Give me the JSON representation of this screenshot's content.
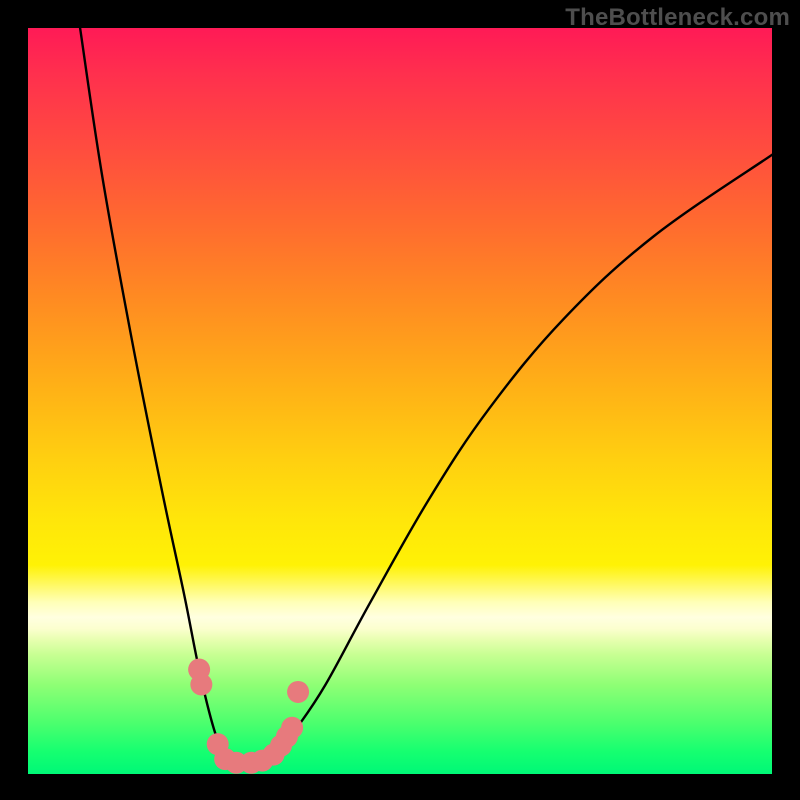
{
  "watermark": "TheBottleneck.com",
  "chart_data": {
    "type": "line",
    "title": "",
    "xlabel": "",
    "ylabel": "",
    "xlim": [
      0,
      100
    ],
    "ylim": [
      0,
      100
    ],
    "series": [
      {
        "name": "curve",
        "x": [
          7,
          10,
          14,
          18,
          21,
          23,
          25,
          26.5,
          28,
          30,
          32,
          34,
          36,
          40,
          46,
          54,
          62,
          72,
          84,
          100
        ],
        "y": [
          100,
          80,
          58,
          38,
          24,
          14,
          6,
          2.5,
          1.5,
          1.5,
          2,
          3.5,
          6,
          12,
          23,
          37,
          49,
          61,
          72,
          83
        ]
      }
    ],
    "markers": {
      "name": "highlight-dots",
      "color": "#e77a7d",
      "points": [
        {
          "x": 23.0,
          "y": 14.0
        },
        {
          "x": 23.3,
          "y": 12.0
        },
        {
          "x": 25.5,
          "y": 4.0
        },
        {
          "x": 26.5,
          "y": 2.0
        },
        {
          "x": 28.0,
          "y": 1.5
        },
        {
          "x": 30.0,
          "y": 1.5
        },
        {
          "x": 31.5,
          "y": 1.8
        },
        {
          "x": 33.0,
          "y": 2.6
        },
        {
          "x": 34.0,
          "y": 3.8
        },
        {
          "x": 34.8,
          "y": 5.0
        },
        {
          "x": 35.5,
          "y": 6.2
        },
        {
          "x": 36.3,
          "y": 11.0
        }
      ]
    },
    "gradient_bands": [
      {
        "stop": 0,
        "color": "#ff1a56"
      },
      {
        "stop": 46,
        "color": "#ffaa18"
      },
      {
        "stop": 72,
        "color": "#fff205"
      },
      {
        "stop": 80,
        "color": "#fcffcf"
      },
      {
        "stop": 100,
        "color": "#00f877"
      }
    ]
  }
}
